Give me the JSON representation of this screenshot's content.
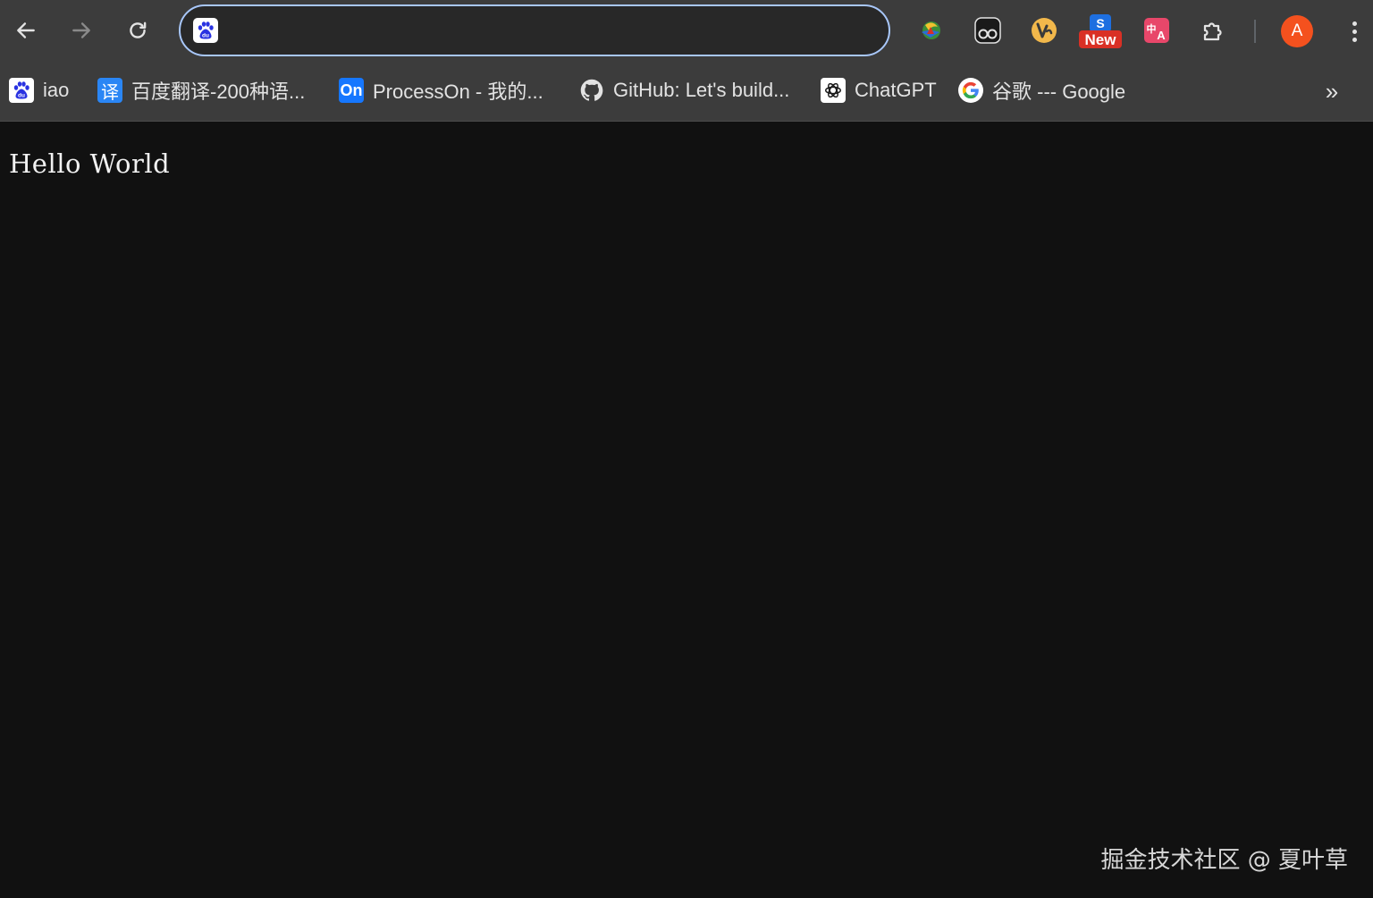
{
  "toolbar": {
    "back_icon": "arrow-left-icon",
    "forward_icon": "arrow-right-icon",
    "reload_icon": "reload-icon",
    "omnibox": {
      "value": "",
      "site_icon": "baidu-paw-icon",
      "border_color": "#a8c7fa"
    },
    "extensions": [
      {
        "name": "download-manager-icon"
      },
      {
        "name": "tampermonkey-icon"
      },
      {
        "name": "vue-devtools-icon"
      },
      {
        "name": "new-badge-extension-icon",
        "badge": "New"
      },
      {
        "name": "translate-extension-icon"
      },
      {
        "name": "puzzle-extensions-icon"
      }
    ],
    "avatar_letter": "A",
    "avatar_color": "#f4511e",
    "menu_icon": "more-vert-icon"
  },
  "bookmarks": [
    {
      "label": "iao",
      "icon": "baidu-paw-icon"
    },
    {
      "label": "百度翻译-200种语...",
      "icon": "baidu-translate-icon",
      "icon_text": "译"
    },
    {
      "label": "ProcessOn - 我的...",
      "icon": "processon-icon",
      "icon_text": "On"
    },
    {
      "label": "GitHub: Let's build...",
      "icon": "github-icon"
    },
    {
      "label": "ChatGPT",
      "icon": "chatgpt-icon"
    },
    {
      "label": "谷歌 --- Google",
      "icon": "google-icon"
    }
  ],
  "bookmarks_more": "»",
  "page": {
    "text": "Hello World"
  },
  "watermark": "掘金技术社区 @ 夏叶草"
}
